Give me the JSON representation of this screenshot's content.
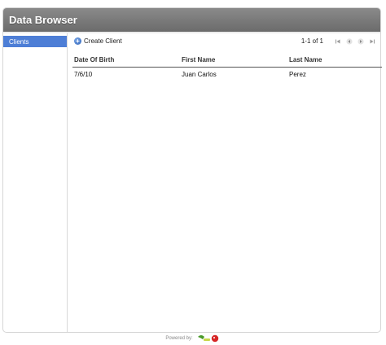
{
  "app": {
    "title": "Data Browser"
  },
  "sidebar": {
    "items": [
      {
        "label": "Clients",
        "selected": true
      }
    ]
  },
  "toolbar": {
    "create_label": "Create Client",
    "pager_text": "1-1 of 1"
  },
  "table": {
    "columns": [
      "Date Of Birth",
      "First Name",
      "Last Name"
    ],
    "rows": [
      [
        "7/6/10",
        "Juan Carlos",
        "Perez"
      ]
    ]
  },
  "footer": {
    "powered_by": "Powered by:"
  },
  "colors": {
    "header": "#6b6b6b",
    "sidebar_selected": "#4d7ed6"
  },
  "icons": [
    "plus-circle-icon",
    "first-page-icon",
    "prev-page-icon",
    "next-page-icon",
    "last-page-icon",
    "logo-icon"
  ]
}
